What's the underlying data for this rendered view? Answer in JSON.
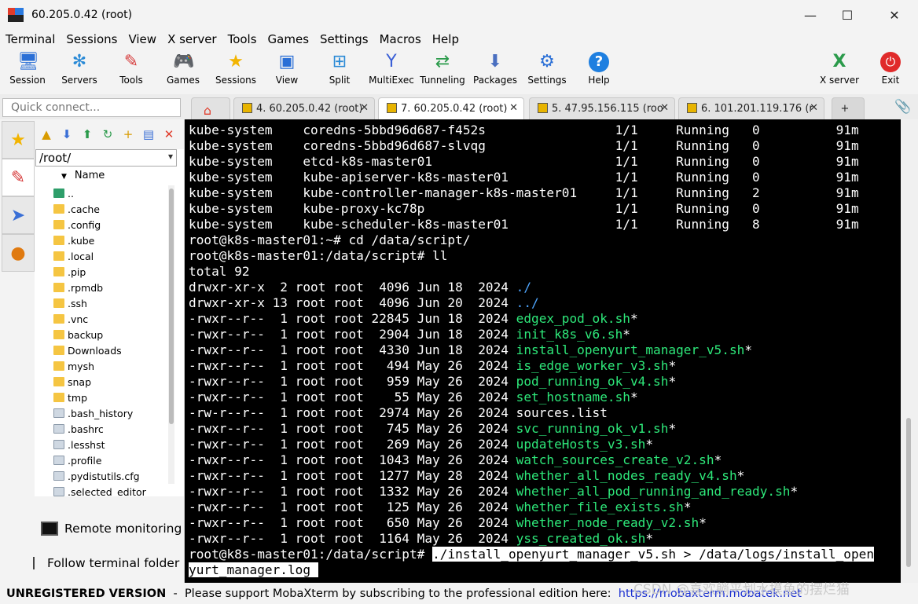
{
  "window": {
    "title": "60.205.0.42 (root)",
    "minimize": "—",
    "maximize": "☐",
    "close": "✕"
  },
  "menu": [
    "Terminal",
    "Sessions",
    "View",
    "X server",
    "Tools",
    "Games",
    "Settings",
    "Macros",
    "Help"
  ],
  "toolbar": [
    {
      "label": "Session",
      "icon": "session-icon"
    },
    {
      "label": "Servers",
      "icon": "servers-icon"
    },
    {
      "label": "Tools",
      "icon": "tools-icon"
    },
    {
      "label": "Games",
      "icon": "games-icon"
    },
    {
      "label": "Sessions",
      "icon": "star-icon"
    },
    {
      "label": "View",
      "icon": "view-icon"
    },
    {
      "label": "Split",
      "icon": "split-icon"
    },
    {
      "label": "MultiExec",
      "icon": "multiexec-icon"
    },
    {
      "label": "Tunneling",
      "icon": "tunneling-icon"
    },
    {
      "label": "Packages",
      "icon": "packages-icon"
    },
    {
      "label": "Settings",
      "icon": "settings-icon"
    },
    {
      "label": "Help",
      "icon": "help-icon"
    },
    {
      "label": "X server",
      "icon": "xserver-icon"
    },
    {
      "label": "Exit",
      "icon": "exit-icon"
    }
  ],
  "quick_connect": {
    "placeholder": "Quick connect..."
  },
  "tabs": [
    {
      "label": "4. 60.205.0.42 (root)",
      "active": false
    },
    {
      "label": "7. 60.205.0.42 (root)",
      "active": true
    },
    {
      "label": "5. 47.95.156.115 (roo",
      "active": false
    },
    {
      "label": "6. 101.201.119.176 (r",
      "active": false
    }
  ],
  "file_browser": {
    "path": "/root/",
    "column": "Name",
    "items": [
      {
        "name": "..",
        "kind": "up"
      },
      {
        "name": ".cache",
        "kind": "folder"
      },
      {
        "name": ".config",
        "kind": "folder"
      },
      {
        "name": ".kube",
        "kind": "folder"
      },
      {
        "name": ".local",
        "kind": "folder"
      },
      {
        "name": ".pip",
        "kind": "folder"
      },
      {
        "name": ".rpmdb",
        "kind": "folder"
      },
      {
        "name": ".ssh",
        "kind": "folder"
      },
      {
        "name": ".vnc",
        "kind": "folder"
      },
      {
        "name": "backup",
        "kind": "folder"
      },
      {
        "name": "Downloads",
        "kind": "folder"
      },
      {
        "name": "mysh",
        "kind": "folder"
      },
      {
        "name": "snap",
        "kind": "folder"
      },
      {
        "name": "tmp",
        "kind": "folder"
      },
      {
        "name": ".bash_history",
        "kind": "file"
      },
      {
        "name": ".bashrc",
        "kind": "file"
      },
      {
        "name": ".lesshst",
        "kind": "file"
      },
      {
        "name": ".profile",
        "kind": "file"
      },
      {
        "name": ".pydistutils.cfg",
        "kind": "file"
      },
      {
        "name": ".selected_editor",
        "kind": "file"
      }
    ],
    "remote_monitoring": "Remote monitoring",
    "follow_folder": "Follow terminal folder"
  },
  "terminal": {
    "lines": [
      [
        {
          "t": "kube-system    coredns-5bbd96d687-f452s                 1/1     Running   0          91m"
        }
      ],
      [
        {
          "t": "kube-system    coredns-5bbd96d687-slvqg                 1/1     Running   0          91m"
        }
      ],
      [
        {
          "t": "kube-system    etcd-k8s-master01                        1/1     Running   0          91m"
        }
      ],
      [
        {
          "t": "kube-system    kube-apiserver-k8s-master01              1/1     Running   0          91m"
        }
      ],
      [
        {
          "t": "kube-system    kube-controller-manager-k8s-master01     1/1     Running   2          91m"
        }
      ],
      [
        {
          "t": "kube-system    kube-proxy-kc78p                         1/1     Running   0          91m"
        }
      ],
      [
        {
          "t": "kube-system    kube-scheduler-k8s-master01              1/1     Running   8          91m"
        }
      ],
      [
        {
          "t": "root@k8s-master01:~# cd /data/script/"
        }
      ],
      [
        {
          "t": "root@k8s-master01:/data/script# ll"
        }
      ],
      [
        {
          "t": "total 92"
        }
      ],
      [
        {
          "t": "drwxr-xr-x  2 root root  4096 Jun 18  2024 "
        },
        {
          "t": "./",
          "c": "dir"
        }
      ],
      [
        {
          "t": "drwxr-xr-x 13 root root  4096 Jun 20  2024 "
        },
        {
          "t": "../",
          "c": "dir"
        }
      ],
      [
        {
          "t": "-rwxr--r--  1 root root 22845 Jun 18  2024 "
        },
        {
          "t": "edgex_pod_ok.sh",
          "c": "hl"
        },
        {
          "t": "*"
        }
      ],
      [
        {
          "t": "-rwxr--r--  1 root root  2904 Jun 18  2024 "
        },
        {
          "t": "init_k8s_v6.sh",
          "c": "hl"
        },
        {
          "t": "*"
        }
      ],
      [
        {
          "t": "-rwxr--r--  1 root root  4330 Jun 18  2024 "
        },
        {
          "t": "install_openyurt_manager_v5.sh",
          "c": "hl"
        },
        {
          "t": "*"
        }
      ],
      [
        {
          "t": "-rwxr--r--  1 root root   494 May 26  2024 "
        },
        {
          "t": "is_edge_worker_v3.sh",
          "c": "hl"
        },
        {
          "t": "*"
        }
      ],
      [
        {
          "t": "-rwxr--r--  1 root root   959 May 26  2024 "
        },
        {
          "t": "pod_running_ok_v4.sh",
          "c": "hl"
        },
        {
          "t": "*"
        }
      ],
      [
        {
          "t": "-rwxr--r--  1 root root    55 May 26  2024 "
        },
        {
          "t": "set_hostname.sh",
          "c": "hl"
        },
        {
          "t": "*"
        }
      ],
      [
        {
          "t": "-rw-r--r--  1 root root  2974 May 26  2024 sources.list"
        }
      ],
      [
        {
          "t": "-rwxr--r--  1 root root   745 May 26  2024 "
        },
        {
          "t": "svc_running_ok_v1.sh",
          "c": "hl"
        },
        {
          "t": "*"
        }
      ],
      [
        {
          "t": "-rwxr--r--  1 root root   269 May 26  2024 "
        },
        {
          "t": "updateHosts_v3.sh",
          "c": "hl"
        },
        {
          "t": "*"
        }
      ],
      [
        {
          "t": "-rwxr--r--  1 root root  1043 May 26  2024 "
        },
        {
          "t": "watch_sources_create_v2.sh",
          "c": "hl"
        },
        {
          "t": "*"
        }
      ],
      [
        {
          "t": "-rwxr--r--  1 root root  1277 May 28  2024 "
        },
        {
          "t": "whether_all_nodes_ready_v4.sh",
          "c": "hl"
        },
        {
          "t": "*"
        }
      ],
      [
        {
          "t": "-rwxr--r--  1 root root  1332 May 26  2024 "
        },
        {
          "t": "whether_all_pod_running_and_ready.sh",
          "c": "hl"
        },
        {
          "t": "*"
        }
      ],
      [
        {
          "t": "-rwxr--r--  1 root root   125 May 26  2024 "
        },
        {
          "t": "whether_file_exists.sh",
          "c": "hl"
        },
        {
          "t": "*"
        }
      ],
      [
        {
          "t": "-rwxr--r--  1 root root   650 May 26  2024 "
        },
        {
          "t": "whether_node_ready_v2.sh",
          "c": "hl"
        },
        {
          "t": "*"
        }
      ],
      [
        {
          "t": "-rwxr--r--  1 root root  1164 May 26  2024 "
        },
        {
          "t": "yss_created_ok.sh",
          "c": "hl"
        },
        {
          "t": "*"
        }
      ],
      [
        {
          "t": "root@k8s-master01:/data/script# "
        },
        {
          "t": "./install_openyurt_manager_v5.sh > /data/logs/install_open",
          "c": "cmd"
        }
      ],
      [
        {
          "t": "yurt_manager.log ",
          "c": "cmd"
        }
      ]
    ]
  },
  "status": {
    "unregistered": "UNREGISTERED VERSION",
    "separator": "  -  ",
    "message": "Please support MobaXterm by subscribing to the professional edition here:  ",
    "link": "https://mobaxterm.mobatek.net"
  },
  "watermark": "CSDN @喜欢躺平划水摸鱼的摆烂猫",
  "colors": {
    "accent_green": "#2ee87a",
    "dir_blue": "#4fa6ff",
    "terminal_bg": "#000000"
  }
}
